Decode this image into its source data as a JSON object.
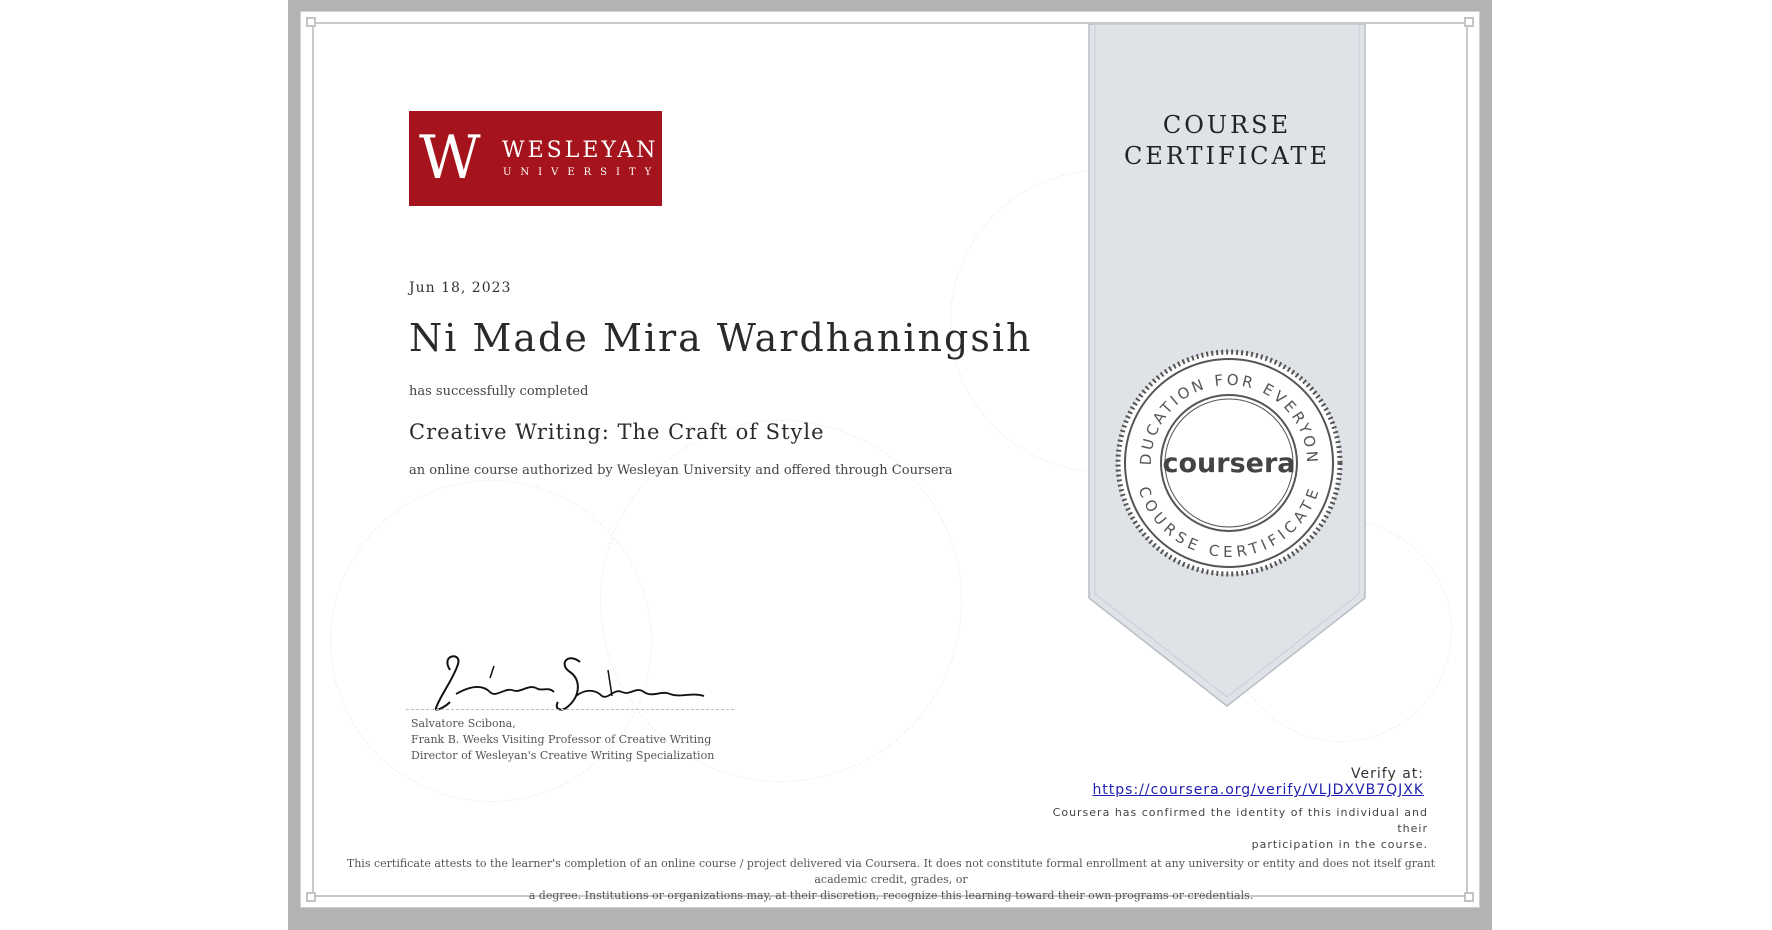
{
  "certificate": {
    "ribbon_title_line1": "COURSE",
    "ribbon_title_line2": "CERTIFICATE",
    "date": "Jun 18, 2023",
    "recipient_name": "Ni Made Mira Wardhaningsih",
    "completion_text": "has successfully completed",
    "course_title": "Creative Writing: The Craft of Style",
    "offered_text": "an online course authorized by Wesleyan University and offered through Coursera"
  },
  "logo": {
    "letter": "W",
    "name": "WESLEYAN",
    "subtitle": "UNIVERSITY",
    "background_color": "#a5141c"
  },
  "seal": {
    "top_text": "EDUCATION FOR EVERYONE",
    "bottom_text": "COURSE CERTIFICATE",
    "brand": "coursera"
  },
  "signer": {
    "name": "Salvatore Scibona,",
    "title_line1": "Frank B. Weeks Visiting Professor of Creative Writing",
    "title_line2": "Director of Wesleyan's Creative Writing Specialization"
  },
  "verification": {
    "label": "Verify at:",
    "url": "https://coursera.org/verify/VLJDXVB7QJXK",
    "confirm_line1": "Coursera has confirmed the identity of this individual and their",
    "confirm_line2": "participation in the course."
  },
  "disclaimer": {
    "line1": "This certificate attests to the learner's completion of an online course / project delivered via Coursera. It does not constitute formal enrollment at any university or entity and does not itself grant academic credit, grades, or",
    "line2": "a degree. Institutions or organizations may, at their discretion, recognize this learning toward their own programs or credentials."
  },
  "colors": {
    "ribbon_fill": "#dfe3e8",
    "frame_gray": "#b3b3b3",
    "link_blue": "#1f1fb0"
  }
}
